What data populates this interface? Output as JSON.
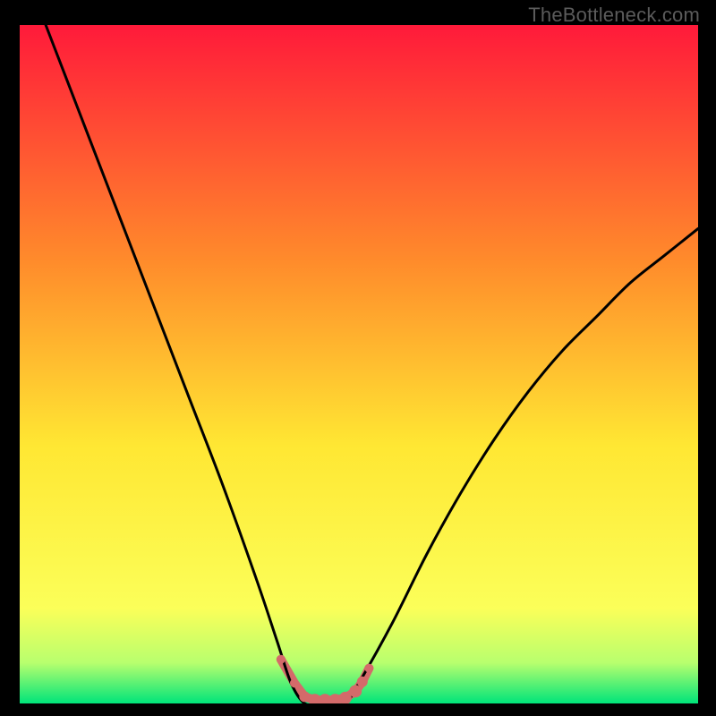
{
  "watermark": "TheBottleneck.com",
  "colors": {
    "frame": "#000000",
    "gradient_top": "#ff1a3a",
    "gradient_upper_mid": "#ff8c2b",
    "gradient_mid": "#ffe733",
    "gradient_lower": "#fbff59",
    "gradient_near_bottom": "#b8ff6e",
    "gradient_bottom": "#00e47a",
    "curve": "#000000",
    "marker": "#d46a6a"
  },
  "chart_data": {
    "type": "line",
    "title": "",
    "xlabel": "",
    "ylabel": "",
    "xlim": [
      0,
      100
    ],
    "ylim": [
      0,
      100
    ],
    "series": [
      {
        "name": "bottleneck-curve",
        "x": [
          0,
          5,
          10,
          15,
          20,
          25,
          30,
          35,
          38,
          40,
          42,
          44,
          46,
          48,
          50,
          55,
          60,
          65,
          70,
          75,
          80,
          85,
          90,
          95,
          100
        ],
        "values": [
          110,
          97,
          84,
          71,
          58,
          45,
          32,
          18,
          9,
          3,
          0,
          0,
          0,
          0,
          3,
          12,
          22,
          31,
          39,
          46,
          52,
          57,
          62,
          66,
          70
        ]
      }
    ],
    "markers": {
      "name": "bottom-markers",
      "x": [
        38.5,
        40.5,
        42,
        43.5,
        45,
        46.5,
        48,
        49.5,
        50.5,
        51.5
      ],
      "values": [
        6.5,
        3.0,
        1.0,
        0.5,
        0.5,
        0.5,
        0.8,
        1.8,
        3.2,
        5.2
      ],
      "radius": [
        5,
        5,
        6,
        7,
        7,
        7,
        7,
        7,
        6,
        5
      ]
    }
  }
}
